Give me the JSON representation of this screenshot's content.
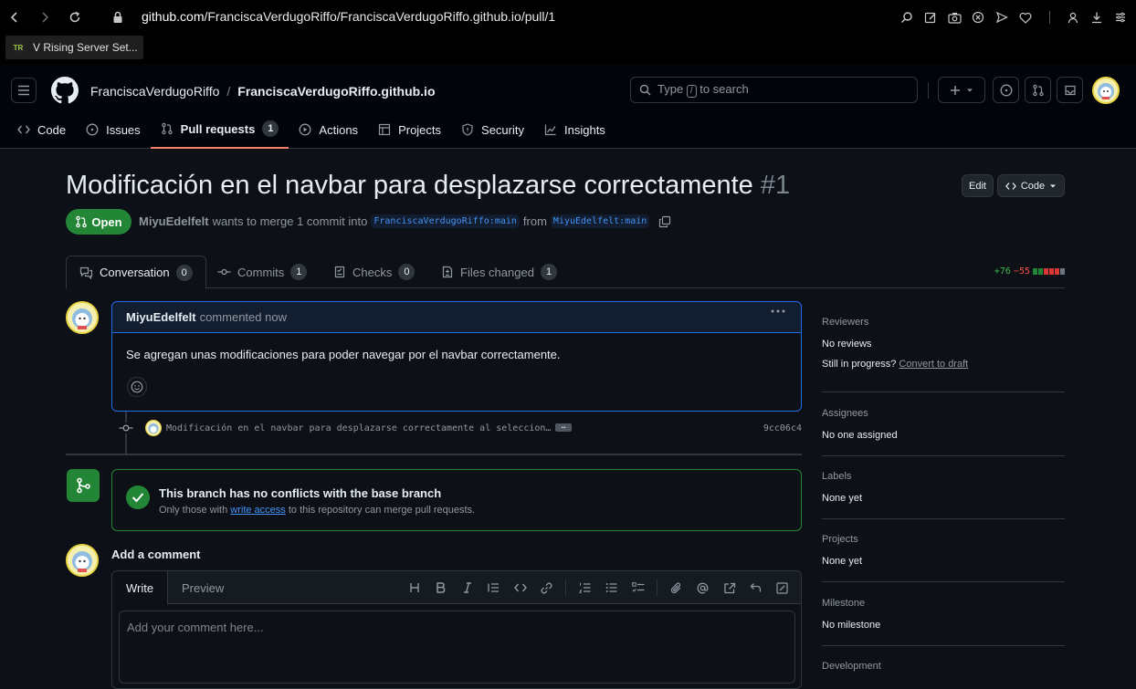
{
  "browser": {
    "url_host": "github.com",
    "url_path": "/FranciscaVerdugoRiffo/FranciscaVerdugoRiffo.github.io/pull/1",
    "bookmark": "V Rising Server Set...",
    "bookmark_favicon": "TR"
  },
  "header": {
    "owner": "FranciscaVerdugoRiffo",
    "separator": "/",
    "repo": "FranciscaVerdugoRiffo.github.io",
    "search_prefix": "Type",
    "search_key": "/",
    "search_suffix": "to search"
  },
  "repo_tabs": [
    {
      "label": "Code",
      "icon": "code-icon"
    },
    {
      "label": "Issues",
      "icon": "issue-icon"
    },
    {
      "label": "Pull requests",
      "icon": "pull-request-icon",
      "count": "1",
      "active": true
    },
    {
      "label": "Actions",
      "icon": "play-icon"
    },
    {
      "label": "Projects",
      "icon": "table-icon"
    },
    {
      "label": "Security",
      "icon": "shield-icon"
    },
    {
      "label": "Insights",
      "icon": "graph-icon"
    }
  ],
  "pr": {
    "title": "Modificación en el navbar para desplazarse correctamente",
    "number": "#1",
    "edit_label": "Edit",
    "code_label": "Code",
    "state": "Open",
    "author": "MiyuEdelfelt",
    "merge_text": "wants to merge 1 commit into",
    "base_branch": "FranciscaVerdugoRiffo:main",
    "from_text": "from",
    "head_branch": "MiyuEdelfelt:main"
  },
  "pr_tabs": [
    {
      "label": "Conversation",
      "count": "0",
      "icon": "comment-discussion-icon"
    },
    {
      "label": "Commits",
      "count": "1",
      "icon": "git-commit-icon"
    },
    {
      "label": "Checks",
      "count": "0",
      "icon": "checklist-icon"
    },
    {
      "label": "Files changed",
      "count": "1",
      "icon": "file-diff-icon"
    }
  ],
  "diffstat": {
    "additions": "+76",
    "deletions": "−55",
    "colors": [
      "#238636",
      "#238636",
      "#da3633",
      "#da3633",
      "#da3633",
      "#6e7681"
    ]
  },
  "comment": {
    "author": "MiyuEdelfelt",
    "time": "commented now",
    "body": "Se agregan unas modificaciones para poder navegar por el navbar correctamente."
  },
  "commit": {
    "message": "Modificación en el navbar para desplazarse correctamente al seleccion…",
    "ellipsis": "…",
    "sha": "9cc06c4"
  },
  "merge": {
    "title": "This branch has no conflicts with the base branch",
    "sub_before": "Only those with",
    "sub_link": "write access",
    "sub_after": "to this repository can merge pull requests."
  },
  "add_comment": {
    "title": "Add a comment",
    "tab_write": "Write",
    "tab_preview": "Preview",
    "placeholder": "Add your comment here..."
  },
  "sidebar": {
    "reviewers_head": "Reviewers",
    "reviewers_val": "No reviews",
    "progress_text": "Still in progress?",
    "progress_link": "Convert to draft",
    "assignees_head": "Assignees",
    "assignees_val": "No one assigned",
    "labels_head": "Labels",
    "labels_val": "None yet",
    "projects_head": "Projects",
    "projects_val": "None yet",
    "milestone_head": "Milestone",
    "milestone_val": "No milestone",
    "development_head": "Development"
  }
}
